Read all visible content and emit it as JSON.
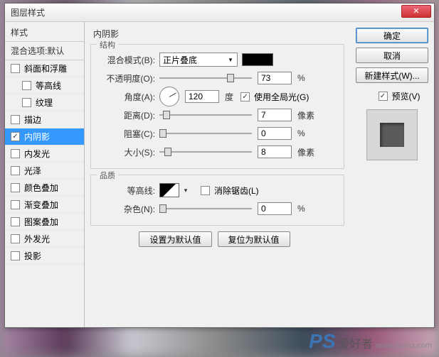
{
  "title": "图层样式",
  "sidebar": {
    "header": "样式",
    "subheader": "混合选项:默认",
    "items": [
      {
        "label": "斜面和浮雕",
        "checked": false,
        "indent": false
      },
      {
        "label": "等高线",
        "checked": false,
        "indent": true
      },
      {
        "label": "纹理",
        "checked": false,
        "indent": true
      },
      {
        "label": "描边",
        "checked": false,
        "indent": false
      },
      {
        "label": "内阴影",
        "checked": true,
        "indent": false,
        "selected": true
      },
      {
        "label": "内发光",
        "checked": false,
        "indent": false
      },
      {
        "label": "光泽",
        "checked": false,
        "indent": false
      },
      {
        "label": "颜色叠加",
        "checked": false,
        "indent": false
      },
      {
        "label": "渐变叠加",
        "checked": false,
        "indent": false
      },
      {
        "label": "图案叠加",
        "checked": false,
        "indent": false
      },
      {
        "label": "外发光",
        "checked": false,
        "indent": false
      },
      {
        "label": "投影",
        "checked": false,
        "indent": false
      }
    ]
  },
  "main": {
    "title": "内阴影",
    "structure": {
      "legend": "结构",
      "blend_mode_label": "混合模式(B):",
      "blend_mode_value": "正片叠底",
      "opacity_label": "不透明度(O):",
      "opacity_value": "73",
      "opacity_unit": "%",
      "angle_label": "角度(A):",
      "angle_value": "120",
      "angle_unit": "度",
      "global_light_label": "使用全局光(G)",
      "distance_label": "距离(D):",
      "distance_value": "7",
      "distance_unit": "像素",
      "choke_label": "阻塞(C):",
      "choke_value": "0",
      "choke_unit": "%",
      "size_label": "大小(S):",
      "size_value": "8",
      "size_unit": "像素"
    },
    "quality": {
      "legend": "品质",
      "contour_label": "等高线:",
      "antialias_label": "消除锯齿(L)",
      "noise_label": "杂色(N):",
      "noise_value": "0",
      "noise_unit": "%"
    },
    "reset_default": "设置为默认值",
    "restore_default": "复位为默认值"
  },
  "right": {
    "ok": "确定",
    "cancel": "取消",
    "new_style": "新建样式(W)...",
    "preview_label": "预览(V)"
  },
  "watermark": {
    "ps": "PS",
    "txt": "爱好者",
    "url": "www.psahz.com"
  }
}
